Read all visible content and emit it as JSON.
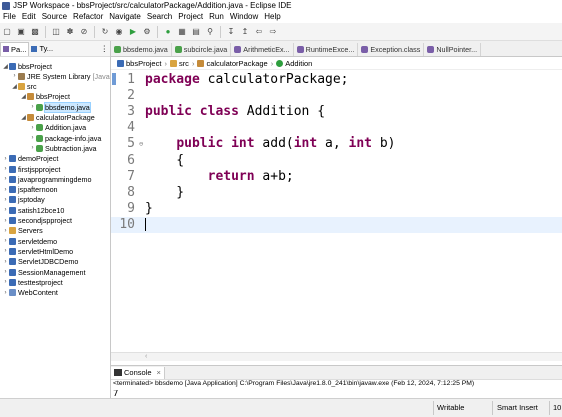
{
  "window": {
    "title": "JSP Workspace - bbsProject/src/calculatorPackage/Addition.java - Eclipse IDE"
  },
  "menu": [
    "File",
    "Edit",
    "Source",
    "Refactor",
    "Navigate",
    "Search",
    "Project",
    "Run",
    "Window",
    "Help"
  ],
  "left_panel": {
    "tabs": [
      "Pa...",
      "Ty..."
    ],
    "tree": [
      {
        "label": "bbsProject",
        "icon": "project-icon",
        "depth": 0,
        "twisty": "open"
      },
      {
        "label": "JRE System Library",
        "suffix": "[JavaS",
        "icon": "library-icon",
        "depth": 1,
        "twisty": "closed"
      },
      {
        "label": "src",
        "icon": "source-folder-icon",
        "depth": 1,
        "twisty": "open"
      },
      {
        "label": "bbsProject",
        "icon": "package-icon",
        "depth": 2,
        "twisty": "open"
      },
      {
        "label": "bbsdemo.java",
        "icon": "java-file-icon",
        "depth": 3,
        "twisty": "closed",
        "selected": true
      },
      {
        "label": "calculatorPackage",
        "icon": "package-icon",
        "depth": 2,
        "twisty": "open"
      },
      {
        "label": "Addition.java",
        "icon": "java-file-icon",
        "depth": 3,
        "twisty": "closed"
      },
      {
        "label": "package-info.java",
        "icon": "java-file-icon",
        "depth": 3,
        "twisty": "closed"
      },
      {
        "label": "Subtraction.java",
        "icon": "java-file-icon",
        "depth": 3,
        "twisty": "closed"
      },
      {
        "label": "demoProject",
        "icon": "project-icon",
        "depth": 0,
        "twisty": "closed"
      },
      {
        "label": "firstjspproject",
        "icon": "project-icon",
        "depth": 0,
        "twisty": "closed"
      },
      {
        "label": "javaprogrammingdemo",
        "icon": "project-icon",
        "depth": 0,
        "twisty": "closed"
      },
      {
        "label": "jspafternoon",
        "icon": "project-icon",
        "depth": 0,
        "twisty": "closed"
      },
      {
        "label": "jsptoday",
        "icon": "project-icon",
        "depth": 0,
        "twisty": "closed"
      },
      {
        "label": "satish12bce10",
        "icon": "project-icon",
        "depth": 0,
        "twisty": "closed"
      },
      {
        "label": "secondjspproject",
        "icon": "project-icon",
        "depth": 0,
        "twisty": "closed"
      },
      {
        "label": "Servers",
        "icon": "folder-icon",
        "depth": 0,
        "twisty": "closed"
      },
      {
        "label": "servletdemo",
        "icon": "project-icon",
        "depth": 0,
        "twisty": "closed"
      },
      {
        "label": "servletHtmlDemo",
        "icon": "project-icon",
        "depth": 0,
        "twisty": "closed"
      },
      {
        "label": "ServletJDBCDemo",
        "icon": "project-icon",
        "depth": 0,
        "twisty": "closed"
      },
      {
        "label": "SessionManagement",
        "icon": "project-icon",
        "depth": 0,
        "twisty": "closed"
      },
      {
        "label": "testtestproject",
        "icon": "project-icon",
        "depth": 0,
        "twisty": "closed"
      },
      {
        "label": "WebContent",
        "icon": "web-folder-icon",
        "depth": 0,
        "twisty": "closed"
      }
    ]
  },
  "editor_tabs": [
    {
      "label": "bbsdemo.java",
      "icon": "java-file-icon"
    },
    {
      "label": "subcircle.java",
      "icon": "java-file-icon"
    },
    {
      "label": "ArithmeticEx...",
      "icon": "class-file-icon"
    },
    {
      "label": "RuntimeExce...",
      "icon": "class-file-icon"
    },
    {
      "label": "Exception.class",
      "icon": "class-file-icon"
    },
    {
      "label": "NullPointer...",
      "icon": "class-file-icon"
    }
  ],
  "breadcrumb": [
    "bbsProject",
    "src",
    "calculatorPackage",
    "Addition"
  ],
  "code": [
    {
      "n": "1",
      "tokens": [
        [
          "kw",
          "package"
        ],
        [
          "t",
          " calculatorPackage;"
        ]
      ]
    },
    {
      "n": "2",
      "tokens": []
    },
    {
      "n": "3",
      "tokens": [
        [
          "kw",
          "public"
        ],
        [
          "t",
          " "
        ],
        [
          "kw",
          "class"
        ],
        [
          "t",
          " Addition {"
        ]
      ]
    },
    {
      "n": "4",
      "tokens": []
    },
    {
      "n": "5",
      "fold": true,
      "tokens": [
        [
          "t",
          "    "
        ],
        [
          "kw",
          "public"
        ],
        [
          "t",
          " "
        ],
        [
          "kw",
          "int"
        ],
        [
          "t",
          " add("
        ],
        [
          "kw",
          "int"
        ],
        [
          "t",
          " a, "
        ],
        [
          "kw",
          "int"
        ],
        [
          "t",
          " b)"
        ]
      ]
    },
    {
      "n": "6",
      "tokens": [
        [
          "t",
          "    {"
        ]
      ]
    },
    {
      "n": "7",
      "tokens": [
        [
          "t",
          "        "
        ],
        [
          "kw",
          "return"
        ],
        [
          "t",
          " a+b;"
        ]
      ]
    },
    {
      "n": "8",
      "tokens": [
        [
          "t",
          "    }"
        ]
      ]
    },
    {
      "n": "9",
      "tokens": [
        [
          "t",
          "}"
        ]
      ]
    },
    {
      "n": "10",
      "tokens": [],
      "current": true
    }
  ],
  "console": {
    "tab": "Console",
    "status": "<terminated> bbsdemo [Java Application] C:\\Program Files\\Java\\jre1.8.0_241\\bin\\javaw.exe (Feb 12, 2024, 7:12:25 PM)",
    "output": "7"
  },
  "statusbar": {
    "writable": "Writable",
    "insert_mode": "Smart Insert",
    "position": "10"
  },
  "colors": {
    "keyword": "#7f0055",
    "selection": "#cce8ff",
    "current_line": "#e8f2fe"
  }
}
